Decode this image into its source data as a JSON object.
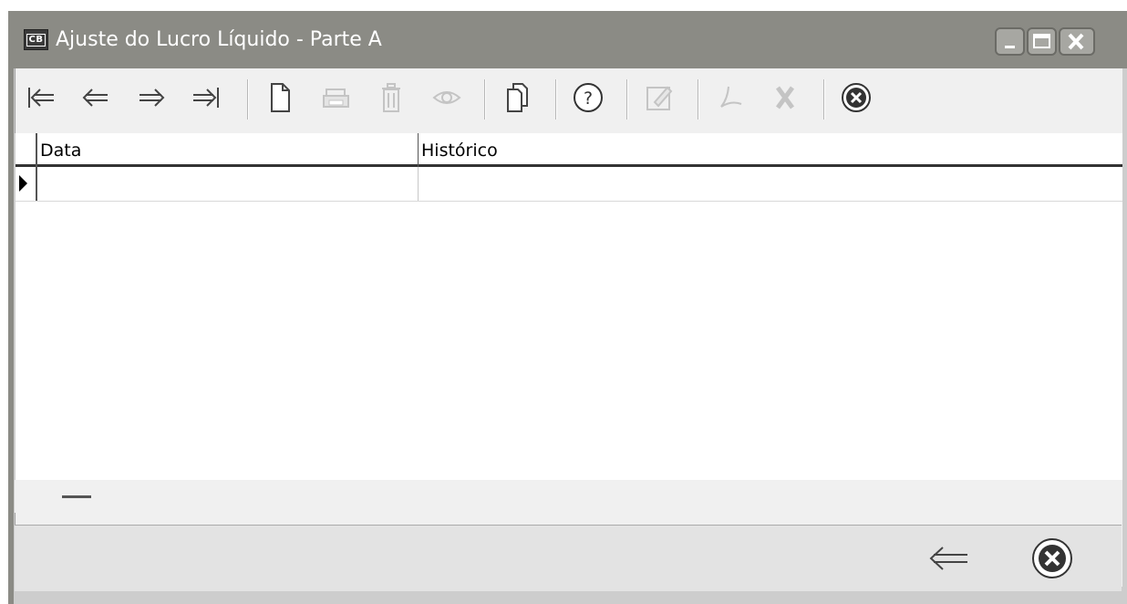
{
  "window": {
    "title": "Ajuste do Lucro Líquido - Parte A",
    "app_badge": "CB",
    "controls": [
      "minimize-icon",
      "maximize-icon",
      "close-icon"
    ]
  },
  "toolbar": {
    "buttons": [
      {
        "name": "first-record",
        "icon": "first-record-icon",
        "enabled": true
      },
      {
        "name": "previous-record",
        "icon": "previous-record-icon",
        "enabled": true
      },
      {
        "name": "next-record",
        "icon": "next-record-icon",
        "enabled": true
      },
      {
        "name": "last-record",
        "icon": "last-record-icon",
        "enabled": true
      },
      {
        "name": "new",
        "icon": "new-document-icon",
        "enabled": true
      },
      {
        "name": "print",
        "icon": "printer-icon",
        "enabled": false
      },
      {
        "name": "delete",
        "icon": "trash-icon",
        "enabled": false
      },
      {
        "name": "view",
        "icon": "eye-icon",
        "enabled": false
      },
      {
        "name": "copy",
        "icon": "copy-icon",
        "enabled": true
      },
      {
        "name": "help",
        "icon": "help-icon",
        "enabled": true
      },
      {
        "name": "edit",
        "icon": "edit-icon",
        "enabled": false
      },
      {
        "name": "pdf",
        "icon": "pdf-icon",
        "enabled": false
      },
      {
        "name": "excel",
        "icon": "excel-icon",
        "enabled": false
      },
      {
        "name": "close",
        "icon": "close-circle-icon",
        "enabled": true
      }
    ]
  },
  "grid": {
    "columns": [
      "Data",
      "Histórico"
    ],
    "rows": [
      [
        "",
        ""
      ]
    ]
  },
  "footer": {
    "buttons": [
      "back-arrow-icon",
      "close-circle-icon"
    ]
  },
  "colors": {
    "titlebar": "#8b8b85",
    "panel": "#f0f0f0",
    "icon": "#444444",
    "disabled_icon": "#c4c4c4"
  }
}
